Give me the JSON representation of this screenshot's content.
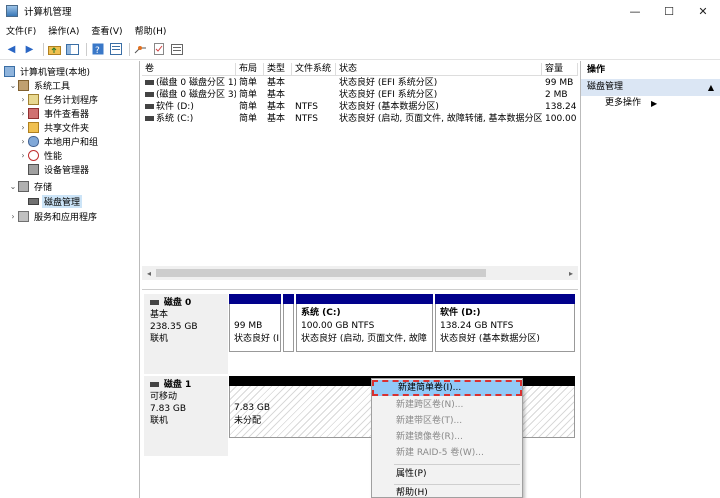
{
  "window": {
    "title": "计算机管理",
    "minimize": "—",
    "maximize": "☐",
    "close": "✕"
  },
  "menu": [
    "文件(F)",
    "操作(A)",
    "查看(V)",
    "帮助(H)"
  ],
  "tree": {
    "root": "计算机管理(本地)",
    "system_tools": "系统工具",
    "items": [
      "任务计划程序",
      "事件查看器",
      "共享文件夹",
      "本地用户和组",
      "性能",
      "设备管理器"
    ],
    "storage": "存储",
    "disk_mgmt": "磁盘管理",
    "services": "服务和应用程序"
  },
  "volume_table": {
    "headers": [
      "卷",
      "布局",
      "类型",
      "文件系统",
      "状态",
      "容量"
    ],
    "rows": [
      [
        "(磁盘 0 磁盘分区 1)",
        "简单",
        "基本",
        "",
        "状态良好 (EFI 系统分区)",
        "99 MB"
      ],
      [
        "(磁盘 0 磁盘分区 3)",
        "简单",
        "基本",
        "",
        "状态良好 (EFI 系统分区)",
        "2 MB"
      ],
      [
        "软件 (D:)",
        "简单",
        "基本",
        "NTFS",
        "状态良好 (基本数据分区)",
        "138.24"
      ],
      [
        "系统 (C:)",
        "简单",
        "基本",
        "NTFS",
        "状态良好 (启动, 页面文件, 故障转储, 基本数据分区)",
        "100.00"
      ]
    ]
  },
  "disk0": {
    "name": "磁盘 0",
    "type": "基本",
    "size": "238.35 GB",
    "status": "联机",
    "partitions": [
      {
        "line1": "99 MB",
        "line2": "状态良好 (I"
      },
      {
        "title": "系统 (C:)",
        "line1": "100.00 GB NTFS",
        "line2": "状态良好 (启动, 页面文件, 故障"
      },
      {
        "title": "软件 (D:)",
        "line1": "138.24 GB NTFS",
        "line2": "状态良好 (基本数据分区)"
      }
    ]
  },
  "disk1": {
    "name": "磁盘 1",
    "type": "可移动",
    "size": "7.83 GB",
    "status": "联机",
    "unalloc": {
      "line1": "7.83 GB",
      "line2": "未分配"
    }
  },
  "context_menu": {
    "new_simple": "新建简单卷(I)...",
    "new_spanned": "新建跨区卷(N)...",
    "new_striped": "新建带区卷(T)...",
    "new_mirrored": "新建镜像卷(R)...",
    "new_raid5": "新建 RAID-5 卷(W)...",
    "properties": "属性(P)",
    "help": "帮助(H)"
  },
  "actions": {
    "header": "操作",
    "section": "磁盘管理",
    "more": "更多操作"
  },
  "colors": {
    "partition_bar": "#00008b",
    "highlight": "#91c9f7",
    "dash_border": "#d93030"
  }
}
